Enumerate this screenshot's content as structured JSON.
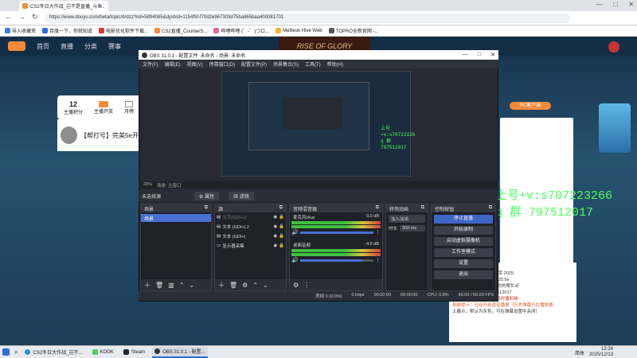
{
  "browser": {
    "tab_title": "CS2冬日大作战_岂不是直播_斗鱼...",
    "url": "https://www.douyu.com/beta/topic/drdzz?rid=5894085&dyshid=1154f5f-f70d2e967303d75ba865baa400081701",
    "bookmarks": [
      "导入收藏夹",
      "百度一下，你就知道",
      "电影优化软件下载...",
      "CS2直播_CounterS...",
      "哔哩哔哩 (゜-゜)つロ...",
      "Meltlesk Hive Web",
      "TOPRO全新官网 -..."
    ]
  },
  "site": {
    "nav": [
      "首页",
      "直播",
      "分类",
      "赛事"
    ],
    "banner_text": "RISE OF GLORY",
    "stats": {
      "followers": "12",
      "label1": "主播积分",
      "label2": "主播开奖",
      "label3": "月榜"
    },
    "room_title": "【帮打号】完美5e开车",
    "pc_button": "PC客户端",
    "chat": [
      "开车",
      "冠军 2021城市赛北京冠军 2025",
      "5e城市季赛北京冠军 2025 5e",
      "梦季赛冲水友开开车 喜欢的帮忙点",
      "个关注 谢谢 水友群797512017",
      "当前房间为彩播内容，同时播彩映~",
      "系统提示：已经开启语音播报（历史弹幕只在播放器",
      "上展示，默认为灰色，可在弹幕设置中关闭）"
    ],
    "overlay": [
      "上号+v:s707223266",
      "q 群 797512017"
    ]
  },
  "obs": {
    "title": "OBS 31.0.1 - 配置文件: 未命名 - 场景: 未命名",
    "menu": [
      "文件(F)",
      "编辑(E)",
      "视图(V)",
      "停靠窗口(D)",
      "配置文件(P)",
      "场景集合(S)",
      "工具(T)",
      "帮助(H)"
    ],
    "preview_overlay": [
      "上号+v:s70722326",
      "q 群 797512017"
    ],
    "status_info": [
      "28%",
      "场景: 主窗口"
    ],
    "source_bar": {
      "label": "未选择源",
      "properties": "属性",
      "filters": "滤镜"
    },
    "docks": {
      "scenes": {
        "title": "场景",
        "items": [
          "场景"
        ]
      },
      "sources": {
        "title": "源",
        "items": [
          "文字(GDI+)2",
          "文本 (GDI+) 2",
          "文本 (GDI+)",
          "显示器采集"
        ]
      },
      "mixer": {
        "title": "音频混音器",
        "tracks": [
          {
            "name": "麦克风/Aux",
            "db": "0.0 dB"
          },
          {
            "name": "桌面音频",
            "db": "-4.6 dB"
          }
        ]
      },
      "transitions": {
        "title": "转场动画",
        "type": "淡入淡出",
        "duration_label": "时长",
        "duration": "300 ms"
      },
      "controls": {
        "title": "控制按钮",
        "buttons": [
          "停止直播",
          "开始录制",
          "启动虚拟摄像机",
          "工作室模式",
          "设置",
          "退出"
        ]
      }
    },
    "statusbar": {
      "dropped": "丢帧 0 (0.0%)",
      "kbps": "0 kbps",
      "time1": "00:00:00",
      "time2": "00:00:00",
      "cpu": "CPU: 0.8%",
      "fps": "60.00 / 60.00 FPS"
    }
  },
  "taskbar": {
    "items": [
      "CS2冬日大作战_岂不...",
      "KOOK",
      "Steam",
      "OBS 31.0.1 - 配置..."
    ],
    "tray": "简体",
    "time": "13:24",
    "date": "2025/12/13"
  },
  "colors": {
    "accent_blue": "#3f65c6",
    "overlay_green": "#4dff5c",
    "orange": "#f58a3a"
  }
}
